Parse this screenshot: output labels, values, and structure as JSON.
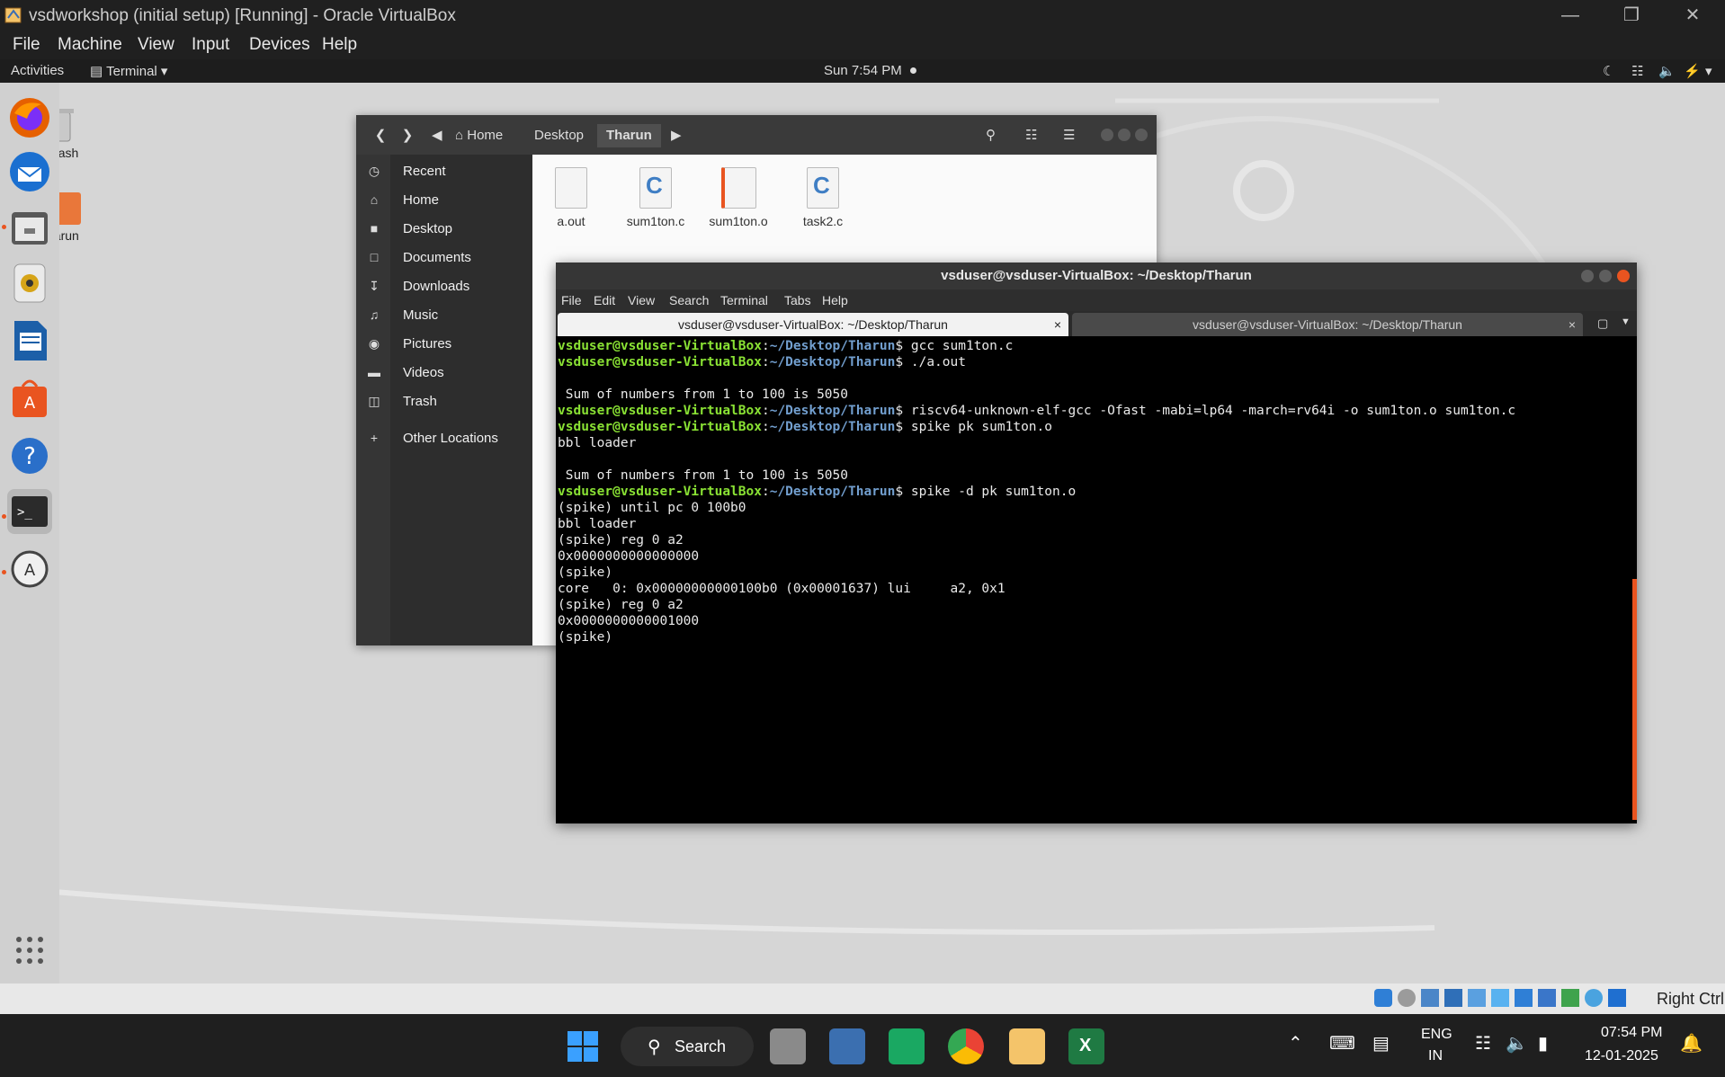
{
  "host": {
    "title": "vsdworkshop (initial setup) [Running] - Oracle VirtualBox",
    "menu": [
      "File",
      "Machine",
      "View",
      "Input",
      "Devices",
      "Help"
    ]
  },
  "gnome": {
    "activities": "Activities",
    "app": "Terminal",
    "clock": "Sun  7:54 PM"
  },
  "desktop_icons": [
    {
      "label": "Trash"
    },
    {
      "label": "harun"
    }
  ],
  "files": {
    "breadcrumbs": [
      "Home",
      "Desktop",
      "Tharun"
    ],
    "sidebar": [
      "Recent",
      "Home",
      "Desktop",
      "Documents",
      "Downloads",
      "Music",
      "Pictures",
      "Videos",
      "Trash",
      "Other Locations"
    ],
    "items": [
      "a.out",
      "sum1ton.c",
      "sum1ton.o",
      "task2.c"
    ]
  },
  "terminal": {
    "title": "vsduser@vsduser-VirtualBox: ~/Desktop/Tharun",
    "menu": [
      "File",
      "Edit",
      "View",
      "Search",
      "Terminal",
      "Tabs",
      "Help"
    ],
    "tabs": [
      "vsduser@vsduser-VirtualBox: ~/Desktop/Tharun",
      "vsduser@vsduser-VirtualBox: ~/Desktop/Tharun"
    ],
    "user": "vsduser@vsduser-VirtualBox",
    "path": "~/Desktop/Tharun",
    "lines": [
      {
        "prompt": true,
        "cmd": "gcc sum1ton.c"
      },
      {
        "prompt": true,
        "cmd": "./a.out"
      },
      {
        "prompt": false,
        "text": ""
      },
      {
        "prompt": false,
        "text": " Sum of numbers from 1 to 100 is 5050"
      },
      {
        "prompt": true,
        "cmd": "riscv64-unknown-elf-gcc -Ofast -mabi=lp64 -march=rv64i -o sum1ton.o sum1ton.c"
      },
      {
        "prompt": true,
        "cmd": "spike pk sum1ton.o"
      },
      {
        "prompt": false,
        "text": "bbl loader"
      },
      {
        "prompt": false,
        "text": ""
      },
      {
        "prompt": false,
        "text": " Sum of numbers from 1 to 100 is 5050"
      },
      {
        "prompt": true,
        "cmd": "spike -d pk sum1ton.o"
      },
      {
        "prompt": false,
        "text": "(spike) until pc 0 100b0"
      },
      {
        "prompt": false,
        "text": "bbl loader"
      },
      {
        "prompt": false,
        "text": "(spike) reg 0 a2"
      },
      {
        "prompt": false,
        "text": "0x0000000000000000"
      },
      {
        "prompt": false,
        "text": "(spike)"
      },
      {
        "prompt": false,
        "text": "core   0: 0x00000000000100b0 (0x00001637) lui     a2, 0x1"
      },
      {
        "prompt": false,
        "text": "(spike) reg 0 a2"
      },
      {
        "prompt": false,
        "text": "0x0000000000001000"
      },
      {
        "prompt": false,
        "text": "(spike)"
      }
    ]
  },
  "vbox_status": {
    "host_key": "Right Ctrl"
  },
  "taskbar": {
    "search": "Search",
    "lang": "ENG",
    "region": "IN",
    "time": "07:54 PM",
    "date": "12-01-2025"
  }
}
